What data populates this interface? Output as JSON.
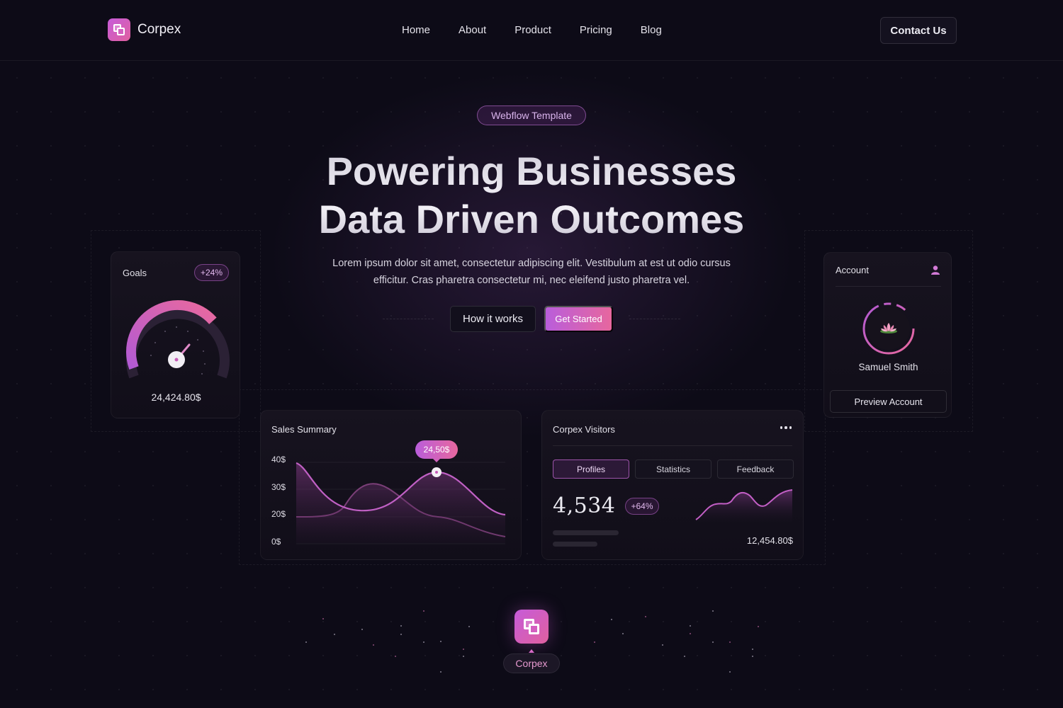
{
  "nav": {
    "brand": "Corpex",
    "links": [
      "Home",
      "About",
      "Product",
      "Pricing",
      "Blog"
    ],
    "contact_label": "Contact Us"
  },
  "hero": {
    "badge": "Webflow Template",
    "title_line1": "Powering Businesses",
    "title_line2": "Data Driven Outcomes",
    "subtitle": "Lorem ipsum dolor sit amet, consectetur adipiscing elit. Vestibulum at est ut odio cursus efficitur. Cras pharetra consectetur mi, nec eleifend justo pharetra vel.",
    "how_label": "How it works",
    "start_label": "Get Started"
  },
  "goals": {
    "title": "Goals",
    "change": "+24%",
    "amount": "24,424.80$",
    "gauge_level": 0.72
  },
  "account": {
    "title": "Account",
    "name": "Samuel Smith",
    "preview_label": "Preview Account"
  },
  "sales": {
    "title": "Sales Summary",
    "tooltip": "24,50$",
    "y_ticks": [
      "40$",
      "30$",
      "20$",
      "0$"
    ]
  },
  "visitors": {
    "title": "Corpex Visitors",
    "tabs": [
      "Profiles",
      "Statistics",
      "Feedback"
    ],
    "active_tab": "Profiles",
    "value": "4,534",
    "change": "+64%",
    "amount": "12,454.80$"
  },
  "footer": {
    "brand": "Corpex"
  },
  "colors": {
    "accent_start": "#b95ddb",
    "accent_end": "#e7679e",
    "background": "#0d0b17"
  }
}
